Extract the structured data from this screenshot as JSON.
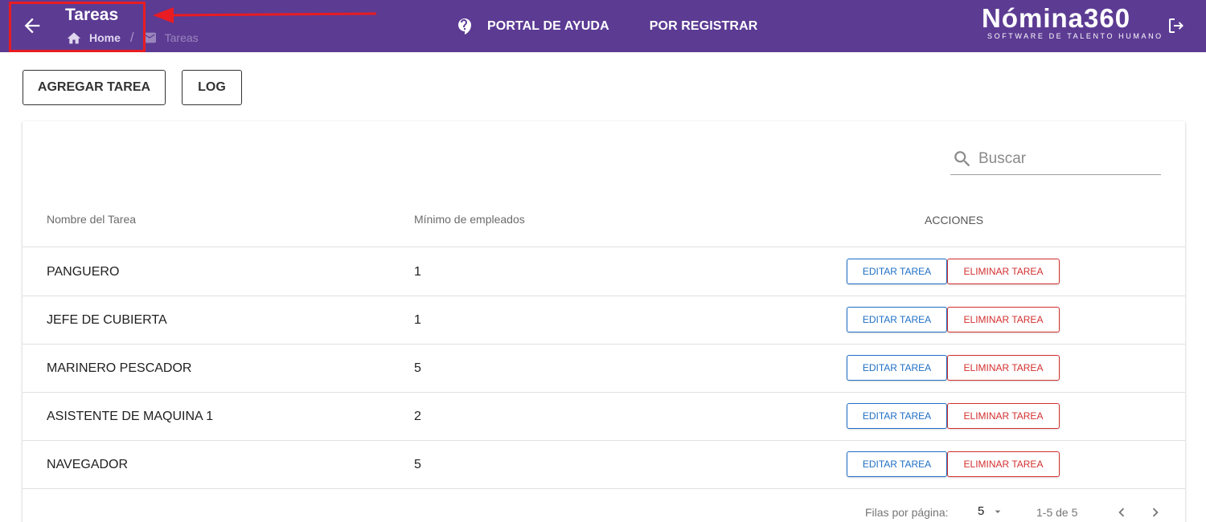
{
  "header": {
    "title": "Tareas",
    "breadcrumb": {
      "home": "Home",
      "separator": "/",
      "current": "Tareas"
    },
    "nav": {
      "help": "PORTAL DE AYUDA",
      "register": "POR REGISTRAR"
    },
    "brand": {
      "name": "Nómina360",
      "tagline": "SOFTWARE DE TALENTO HUMANO"
    },
    "background_color": "#5c3b93"
  },
  "toolbar": {
    "add_label": "AGREGAR TAREA",
    "log_label": "LOG"
  },
  "table": {
    "search_placeholder": "Buscar",
    "columns": [
      "Nombre del Tarea",
      "Mínimo de empleados",
      "ACCIONES"
    ],
    "rows": [
      {
        "name": "PANGUERO",
        "min": "1"
      },
      {
        "name": "JEFE DE CUBIERTA",
        "min": "1"
      },
      {
        "name": "MARINERO PESCADOR",
        "min": "5"
      },
      {
        "name": "ASISTENTE DE MAQUINA 1",
        "min": "2"
      },
      {
        "name": "NAVEGADOR",
        "min": "5"
      }
    ],
    "edit_label": "EDITAR TAREA",
    "delete_label": "ELIMINAR TAREA"
  },
  "pagination": {
    "rows_label": "Filas por página:",
    "rows_value": "5",
    "range": "1-5 de 5"
  },
  "colors": {
    "accent": "#5c3b93",
    "edit": "#1e6fc5",
    "delete": "#d32f2f",
    "annotation": "#e81c22"
  }
}
